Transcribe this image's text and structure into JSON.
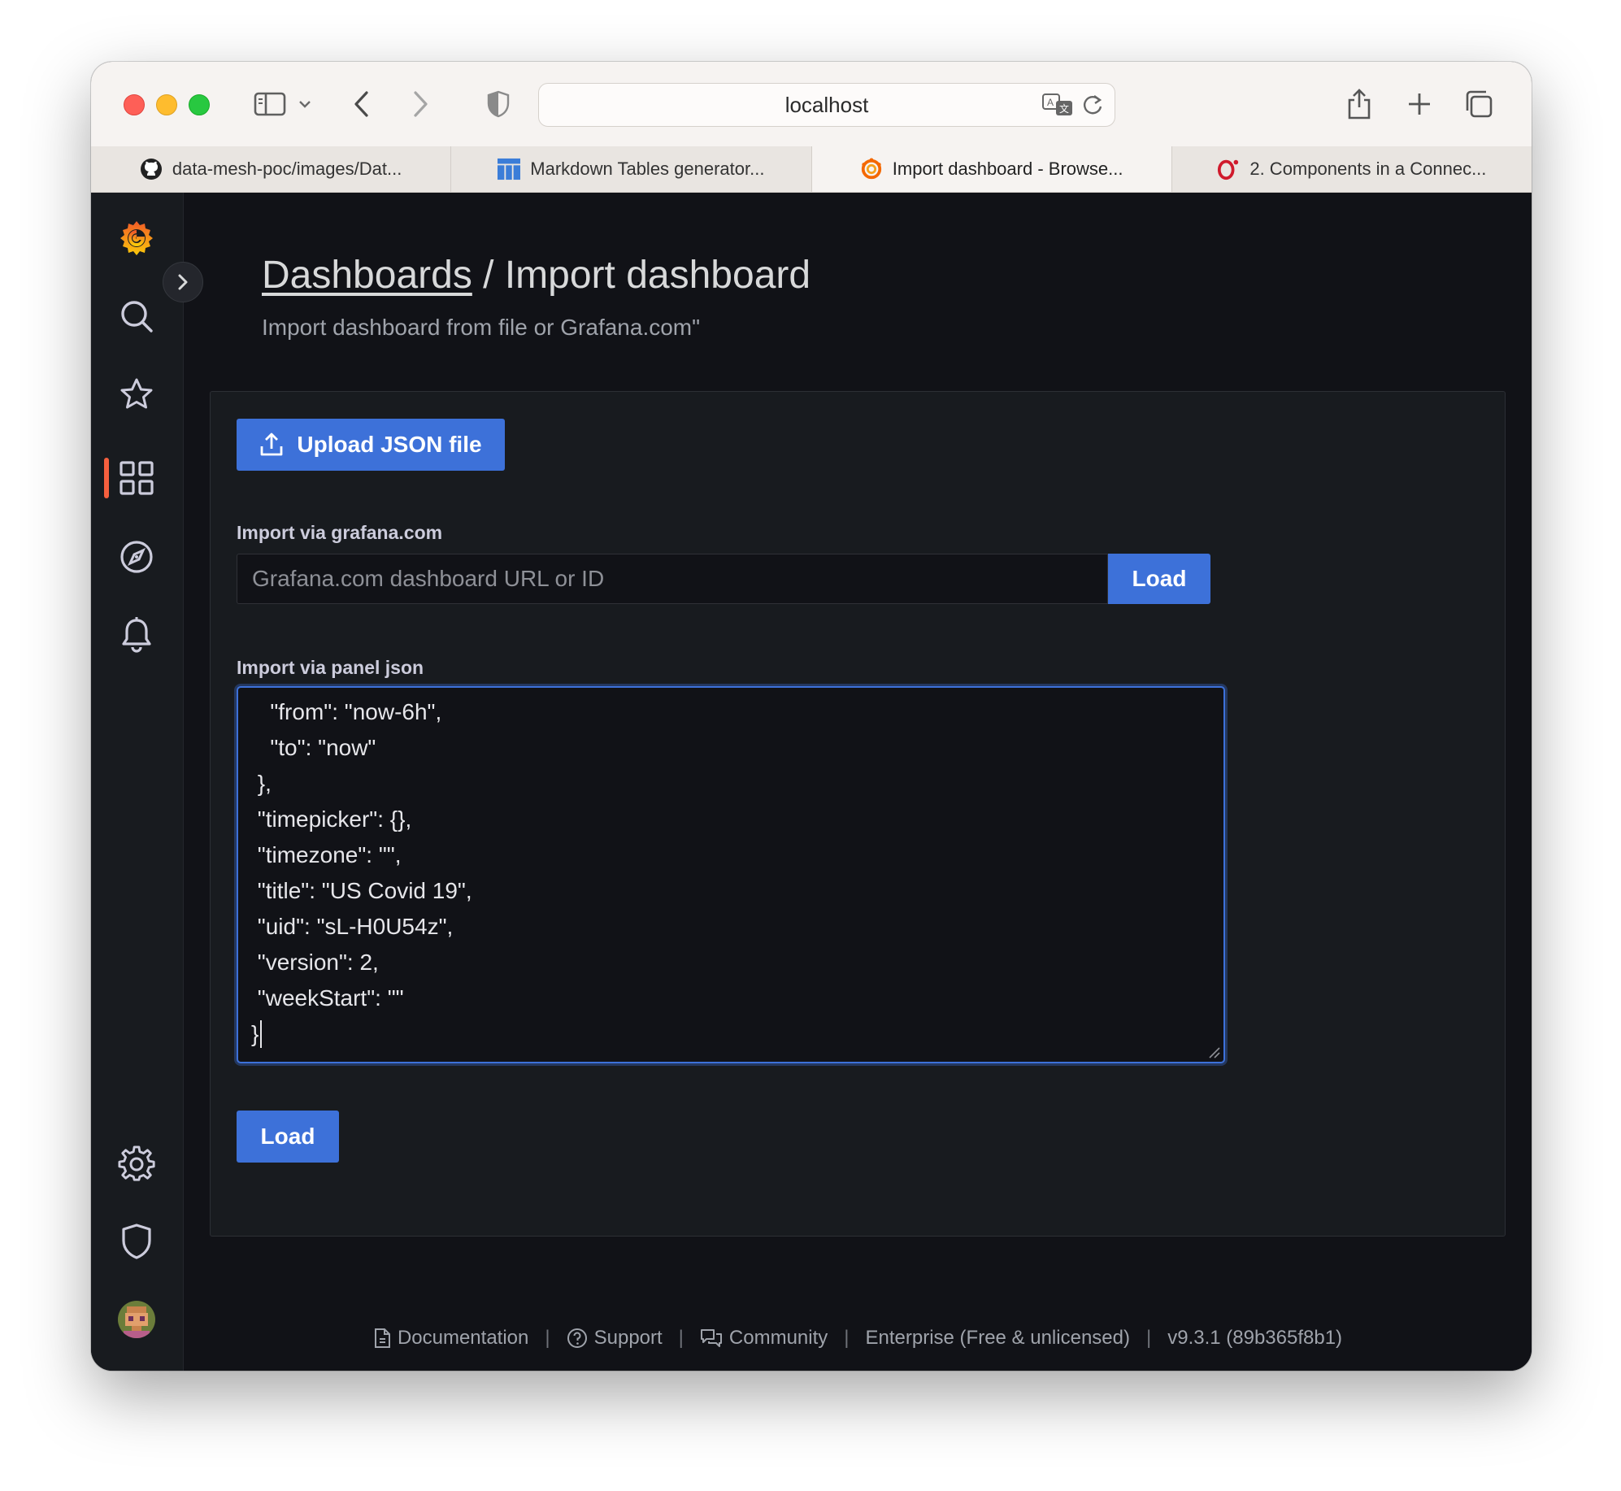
{
  "browser": {
    "url": "localhost",
    "tabs": [
      {
        "title": "data-mesh-poc/images/Dat...",
        "icon": "github-icon",
        "active": false
      },
      {
        "title": "Markdown Tables generator...",
        "icon": "table-icon",
        "active": false
      },
      {
        "title": "Import dashboard - Browse...",
        "icon": "grafana-icon",
        "active": true
      },
      {
        "title": "2. Components in a Connec...",
        "icon": "opera-icon",
        "active": false
      }
    ]
  },
  "sidebar": {
    "items": [
      "grafana-logo",
      "search-icon",
      "starred-icon",
      "dashboards-icon",
      "explore-icon",
      "alerting-icon",
      "configuration-icon",
      "server-admin-icon",
      "user-avatar",
      "help-icon"
    ],
    "active": "dashboards-icon",
    "accent_color": "#f55f3e"
  },
  "header": {
    "breadcrumb": "Dashboards",
    "separator": " / ",
    "title": "Import dashboard",
    "subtitle": "Import dashboard from file or Grafana.com\""
  },
  "import": {
    "upload_label": "Upload JSON file",
    "grafana_label": "Import via grafana.com",
    "grafana_placeholder": "Grafana.com dashboard URL or ID",
    "grafana_value": "",
    "load_label": "Load",
    "panel_json_label": "Import via panel json",
    "json_lines": [
      "   \"from\": \"now-6h\",",
      "   \"to\": \"now\"",
      " },",
      " \"timepicker\": {},",
      " \"timezone\": \"\",",
      " \"title\": \"US Covid 19\",",
      " \"uid\": \"sL-H0U54z\",",
      " \"version\": 2,",
      " \"weekStart\": \"\"",
      "}"
    ],
    "load_json_label": "Load",
    "primary_color": "#3d71d9"
  },
  "footer": {
    "documentation": "Documentation",
    "support": "Support",
    "community": "Community",
    "edition": "Enterprise (Free & unlicensed)",
    "version": "v9.3.1 (89b365f8b1)",
    "separator": "|"
  }
}
